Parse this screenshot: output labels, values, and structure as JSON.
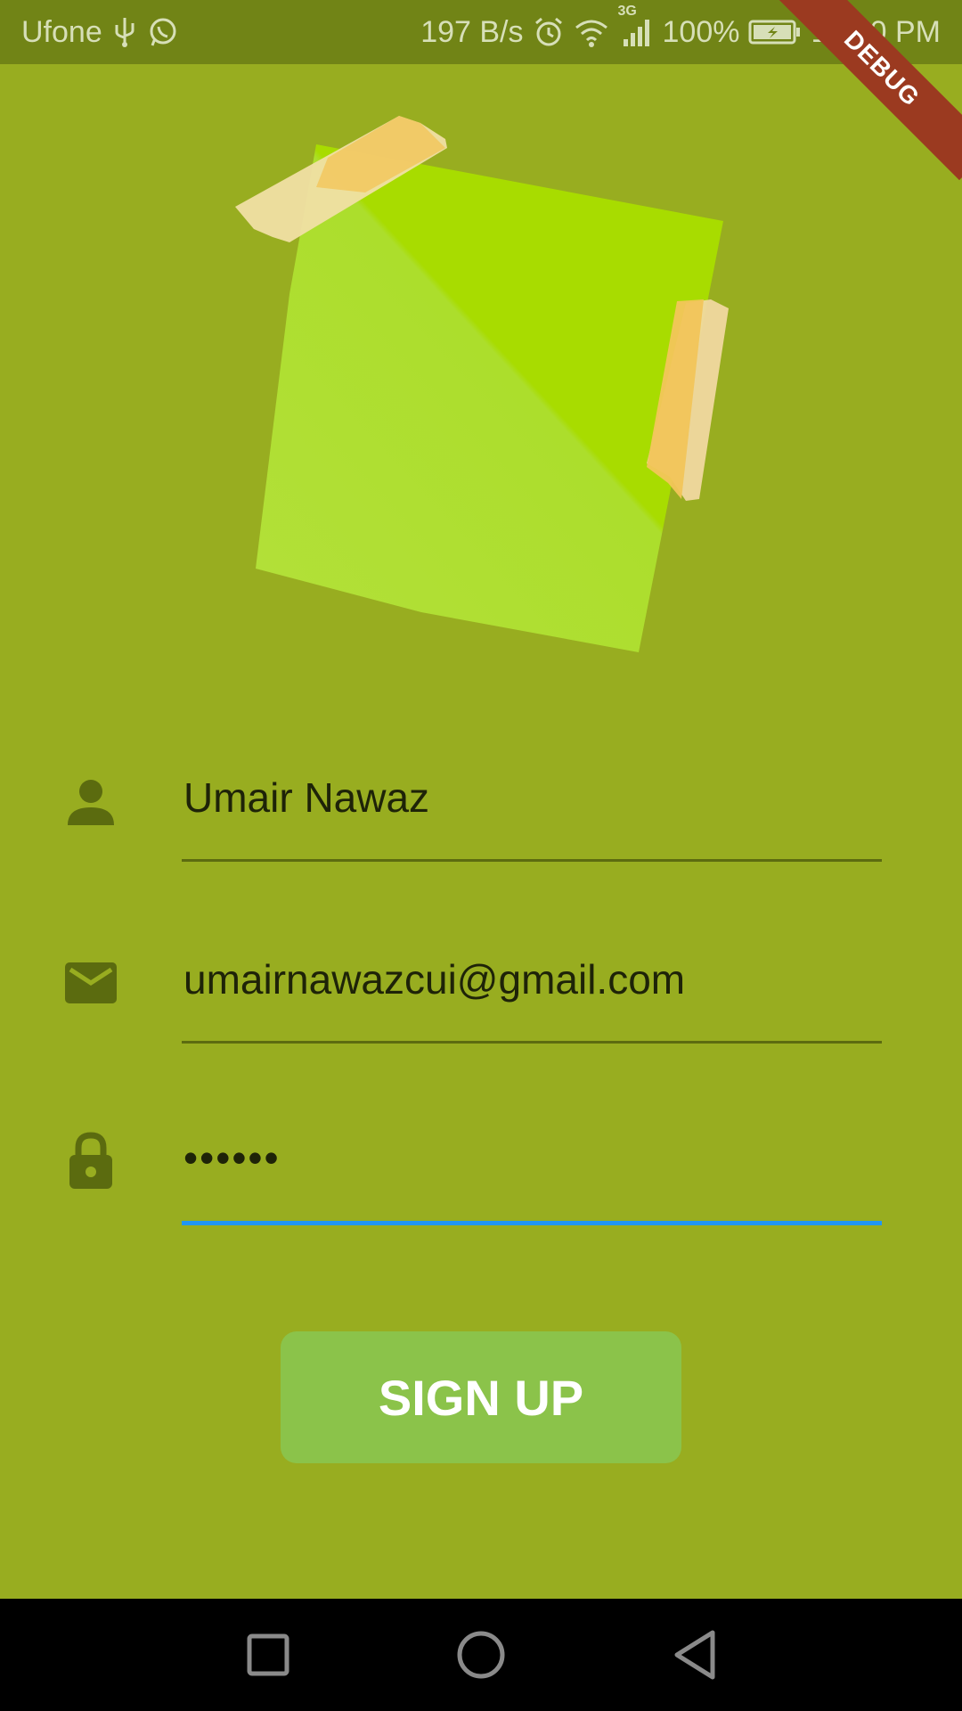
{
  "status_bar": {
    "carrier": "Ufone",
    "net_speed": "197 B/s",
    "network_type": "3G",
    "battery": "100%",
    "time": "12:20 PM",
    "icons": [
      "usb-icon",
      "whatsapp-icon",
      "alarm-icon",
      "wifi-icon",
      "signal-icon",
      "battery-charging-icon"
    ]
  },
  "debug_banner": "DEBUG",
  "form": {
    "name": {
      "value": "Umair Nawaz",
      "icon": "person-icon"
    },
    "email": {
      "value": "umairnawazcui@gmail.com",
      "icon": "mail-icon"
    },
    "password": {
      "value": "••••••",
      "icon": "lock-icon"
    }
  },
  "signup_label": "SIGN UP",
  "nav": {
    "icons": [
      "recents-icon",
      "home-icon",
      "back-icon"
    ]
  },
  "colors": {
    "background": "#98ad20",
    "status_bar": "#718416",
    "button": "#8bc34a",
    "focus_underline": "#2196f3",
    "debug_ribbon": "#9b3a20"
  }
}
